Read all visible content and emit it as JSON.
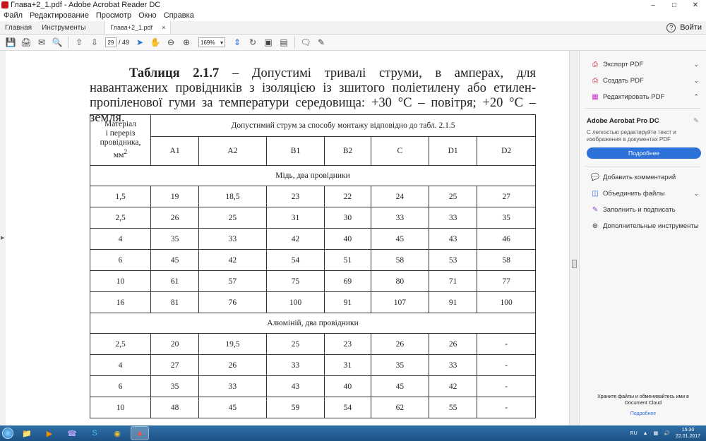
{
  "window": {
    "title": "Глава+2_1.pdf - Adobe Acrobat Reader DC"
  },
  "menu": [
    "Файл",
    "Редактирование",
    "Просмотр",
    "Окно",
    "Справка"
  ],
  "tabs": {
    "home": "Главная",
    "tools": "Инструменты",
    "document": "Глава+2_1.pdf",
    "signin": "Войти"
  },
  "toolbar": {
    "page_current": "29",
    "page_total": "/ 49",
    "zoom": "169%"
  },
  "document": {
    "heading_bold": "Таблиця 2.1.7",
    "heading_text": " – Допустимі тривалі струми, в амперах, для навантажених провідників з ізоляцією із зшитого поліетилену або етилен-пропіленової гуми за температури середовища: +30 °С – повітря; +20 °С – земля.",
    "table": {
      "col0_header_line1": "Матеріал",
      "col0_header_line2": "і переріз",
      "col0_header_line3": "провідника,",
      "col0_header_line4": "мм",
      "col0_header_sup": "2",
      "group_header": "Допустимий струм за способу монтажу відповідно до табл. 2.1.5",
      "columns": [
        "A1",
        "A2",
        "B1",
        "B2",
        "C",
        "D1",
        "D2"
      ],
      "section_copper": "Мідь, два провідники",
      "copper_rows": [
        [
          "1,5",
          "19",
          "18,5",
          "23",
          "22",
          "24",
          "25",
          "27"
        ],
        [
          "2,5",
          "26",
          "25",
          "31",
          "30",
          "33",
          "33",
          "35"
        ],
        [
          "4",
          "35",
          "33",
          "42",
          "40",
          "45",
          "43",
          "46"
        ],
        [
          "6",
          "45",
          "42",
          "54",
          "51",
          "58",
          "53",
          "58"
        ],
        [
          "10",
          "61",
          "57",
          "75",
          "69",
          "80",
          "71",
          "77"
        ],
        [
          "16",
          "81",
          "76",
          "100",
          "91",
          "107",
          "91",
          "100"
        ]
      ],
      "section_aluminium": "Алюміній, два провідники",
      "aluminium_rows": [
        [
          "2,5",
          "20",
          "19,5",
          "25",
          "23",
          "26",
          "26",
          "-"
        ],
        [
          "4",
          "27",
          "26",
          "33",
          "31",
          "35",
          "33",
          "-"
        ],
        [
          "6",
          "35",
          "33",
          "43",
          "40",
          "45",
          "42",
          "-"
        ],
        [
          "10",
          "48",
          "45",
          "59",
          "54",
          "62",
          "55",
          "-"
        ]
      ]
    }
  },
  "right_panel": {
    "items": [
      "Экспорт PDF",
      "Создать PDF",
      "Редактировать PDF"
    ],
    "pro_title": "Adobe Acrobat Pro DC",
    "pro_desc": "С легкостью редактируйте текст и изображения в документах PDF",
    "pro_button": "Подробнее",
    "tools": [
      "Добавить комментарий",
      "Объединить файлы",
      "Заполнить и подписать",
      "Дополнительные инструменты"
    ],
    "dc_text_1": "Храните файлы и обменивайтесь ими в",
    "dc_text_2": "Document Cloud",
    "dc_link": "Подробнее"
  },
  "taskbar": {
    "lang": "RU",
    "time": "15:30",
    "date": "22.01.2017"
  },
  "colors": {
    "accent": "#2d72d9",
    "taskbar": "#1d5284",
    "brand": "#c8141c"
  }
}
